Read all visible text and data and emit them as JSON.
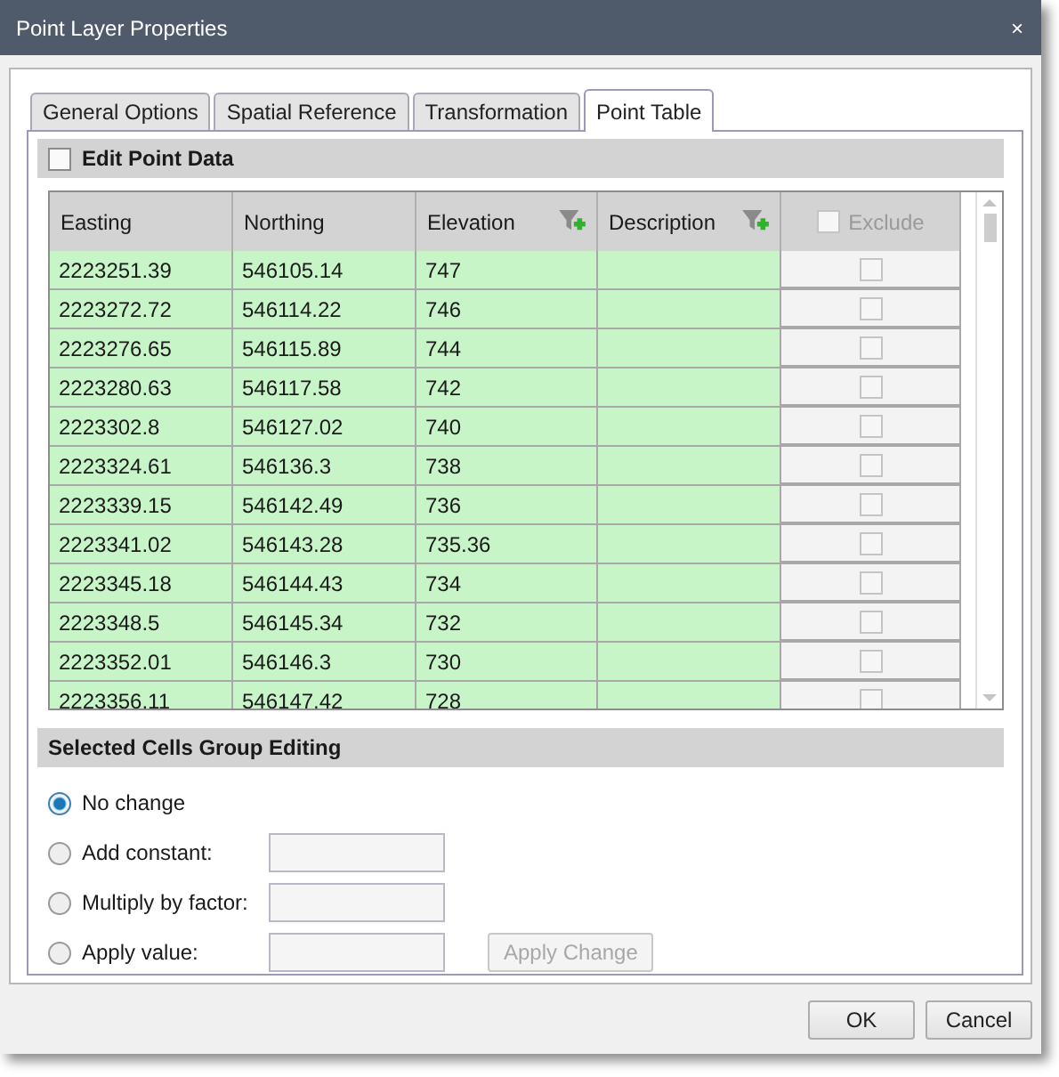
{
  "window": {
    "title": "Point Layer Properties",
    "close": "×"
  },
  "tabs": [
    {
      "label": "General Options",
      "selected": false
    },
    {
      "label": "Spatial Reference",
      "selected": false
    },
    {
      "label": "Transformation",
      "selected": false
    },
    {
      "label": "Point Table",
      "selected": true
    }
  ],
  "edit_point_data": {
    "label": "Edit Point Data",
    "checked": false
  },
  "table": {
    "columns": [
      {
        "label": "Easting",
        "kind": "text",
        "filter": false
      },
      {
        "label": "Northing",
        "kind": "text",
        "filter": false
      },
      {
        "label": "Elevation",
        "kind": "text",
        "filter": true
      },
      {
        "label": "Description",
        "kind": "text",
        "filter": true
      },
      {
        "label": "Exclude",
        "kind": "checkbox",
        "checked": false,
        "disabled": true
      }
    ],
    "rows": [
      {
        "cells": [
          "2223251.39",
          "546105.14",
          "747"
        ],
        "exclude": false
      },
      {
        "cells": [
          "2223272.72",
          "546114.22",
          "746"
        ],
        "exclude": false
      },
      {
        "cells": [
          "2223276.65",
          "546115.89",
          "744"
        ],
        "exclude": false
      },
      {
        "cells": [
          "2223280.63",
          "546117.58",
          "742"
        ],
        "exclude": false
      },
      {
        "cells": [
          "2223302.8",
          "546127.02",
          "740"
        ],
        "exclude": false
      },
      {
        "cells": [
          "2223324.61",
          "546136.3",
          "738"
        ],
        "exclude": false
      },
      {
        "cells": [
          "2223339.15",
          "546142.49",
          "736"
        ],
        "exclude": false
      },
      {
        "cells": [
          "2223341.02",
          "546143.28",
          "735.36"
        ],
        "exclude": false
      },
      {
        "cells": [
          "2223345.18",
          "546144.43",
          "734"
        ],
        "exclude": false
      },
      {
        "cells": [
          "2223348.5",
          "546145.34",
          "732"
        ],
        "exclude": false
      },
      {
        "cells": [
          "2223352.01",
          "546146.3",
          "730"
        ],
        "exclude": false
      },
      {
        "cells": [
          "2223356.11",
          "546147.42",
          "728"
        ],
        "exclude": false
      }
    ]
  },
  "group_editing": {
    "title": "Selected Cells Group Editing",
    "options": [
      {
        "label": "No change",
        "selected": true,
        "kind": "plain"
      },
      {
        "label": "Add constant:",
        "selected": false,
        "kind": "field"
      },
      {
        "label": "Multiply by factor:",
        "selected": false,
        "kind": "field"
      },
      {
        "label": "Apply value:",
        "selected": false,
        "kind": "field_button"
      }
    ],
    "apply_button": {
      "label": "Apply Change",
      "disabled": true
    }
  },
  "buttons": [
    {
      "label": "OK"
    },
    {
      "label": "Cancel"
    }
  ]
}
